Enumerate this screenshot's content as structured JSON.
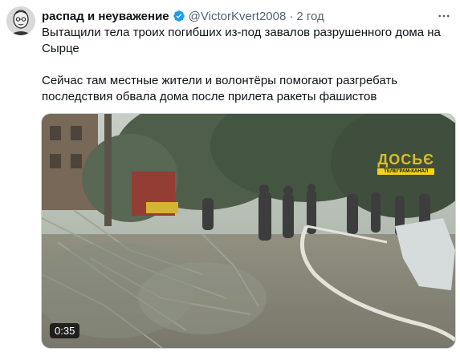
{
  "tweet": {
    "author_name": "распад и неуважение",
    "handle": "@VictorKvert2008",
    "separator": "·",
    "time": "2 год",
    "paragraph1": "Вытащили тела троих погибших из-под завалов разрушенного дома на Сырце",
    "paragraph2": "Сейчас там местные жители и волонтёры помогают разгребать последствия обвала дома после прилета ракеты фашистов"
  },
  "media": {
    "type": "video",
    "duration": "0:35",
    "watermark_main": "ДОСЬЄ",
    "watermark_sub": "ТЕЛЕГРАМ-КАНАЛ"
  },
  "icons": {
    "verified": "verified-badge-icon",
    "more": "more-options-icon"
  },
  "colors": {
    "verified_blue": "#1d9bf0",
    "secondary_text": "#536471",
    "primary_text": "#0f1419"
  }
}
